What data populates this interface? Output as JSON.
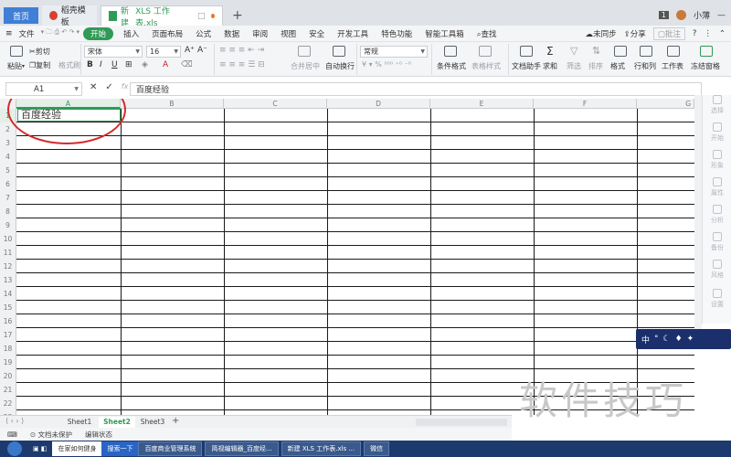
{
  "tabs": {
    "home": "首页",
    "wps_template": "稻壳模板",
    "file_prefix": "新建 ",
    "file_name": "XLS 工作表.xls"
  },
  "window": {
    "badge": "1",
    "user": "小薄"
  },
  "menu": {
    "items": [
      "文件",
      "开始",
      "插入",
      "页面布局",
      "公式",
      "数据",
      "审阅",
      "视图",
      "安全",
      "开发工具",
      "特色功能",
      "智能工具箱",
      "查找"
    ],
    "active": "开始",
    "unsync": "未同步",
    "share": "分享",
    "batch": "批注"
  },
  "ribbon": {
    "paste": "粘贴",
    "cut": "剪切",
    "copy": "复制",
    "format_painter": "格式刷",
    "font_name": "宋体",
    "font_size": "16",
    "number_format": "常规",
    "merge_center": "合并居中",
    "auto_wrap": "自动换行",
    "cond_format": "条件格式",
    "table_style": "表格样式",
    "doc_helper": "文档助手",
    "sum": "求和",
    "filter": "筛选",
    "sort": "排序",
    "format": "格式",
    "row_col": "行和列",
    "worksheet": "工作表",
    "freeze": "冻结窗格"
  },
  "formula_bar": {
    "name_box": "A1",
    "fx": "fx",
    "value": "百度经验"
  },
  "grid": {
    "columns": [
      "A",
      "B",
      "C",
      "D",
      "E",
      "F",
      "G"
    ],
    "rows": [
      "1",
      "2",
      "3",
      "4",
      "5",
      "6",
      "7",
      "8",
      "9",
      "10",
      "11",
      "12",
      "13",
      "14",
      "15",
      "16",
      "17",
      "18",
      "19",
      "20",
      "21",
      "22",
      "23"
    ],
    "a1_value": "百度经验",
    "selected_cell": "A1"
  },
  "right_panel": [
    "选择",
    "开始",
    "形象",
    "属性",
    "分析",
    "备份",
    "风格",
    "设置"
  ],
  "sheets": {
    "tabs": [
      "Sheet1",
      "Sheet2",
      "Sheet3"
    ],
    "active": "Sheet2",
    "add": "+"
  },
  "status": {
    "doc_protect": "文档未保护",
    "edit_state": "编辑状态"
  },
  "taskbar": {
    "items": [
      "在家如何健身",
      "搜索一下",
      "百度商业管理系统",
      "简视编辑器_百度经...",
      "新建 XLS 工作表.xls ...",
      "微信"
    ]
  },
  "ime": {
    "label": "中"
  },
  "watermark": "软件技巧",
  "colors": {
    "accent_green": "#2f9b56",
    "home_tab_blue": "#3f7fd6",
    "annotation_red": "#d22b2b",
    "taskbar_bg": "#1d3a6e"
  }
}
